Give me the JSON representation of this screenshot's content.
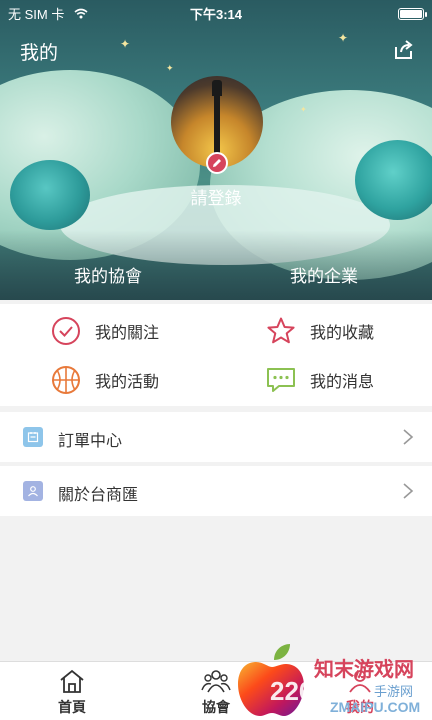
{
  "status_bar": {
    "carrier": "无 SIM 卡",
    "time": "下午3:14"
  },
  "header": {
    "title": "我的"
  },
  "profile": {
    "login_text": "請登錄"
  },
  "hero_tabs": {
    "association": "我的協會",
    "enterprise": "我的企業"
  },
  "grid": [
    {
      "label": "我的關注",
      "icon": "check-circle-icon",
      "color": "#d6445c"
    },
    {
      "label": "我的收藏",
      "icon": "star-icon",
      "color": "#d6445c"
    },
    {
      "label": "我的活動",
      "icon": "basketball-icon",
      "color": "#e8793a"
    },
    {
      "label": "我的消息",
      "icon": "message-icon",
      "color": "#8cc152"
    }
  ],
  "list": [
    {
      "label": "訂單中心",
      "icon": "order-icon",
      "color": "#8ec5ea"
    },
    {
      "label": "關於台商匯",
      "icon": "about-icon",
      "color": "#a3b3e2"
    }
  ],
  "tabbar": [
    {
      "label": "首頁",
      "icon": "home-icon"
    },
    {
      "label": "協會",
      "icon": "association-icon"
    },
    {
      "label": "我的",
      "icon": "profile-icon",
      "active": true
    }
  ],
  "watermark": {
    "brand": "知末游戏网",
    "sub": "手游网",
    "domain": "ZMAIPU.COM",
    "num": "2265"
  },
  "colors": {
    "accent": "#d6445c",
    "background": "#f2f2f2"
  }
}
